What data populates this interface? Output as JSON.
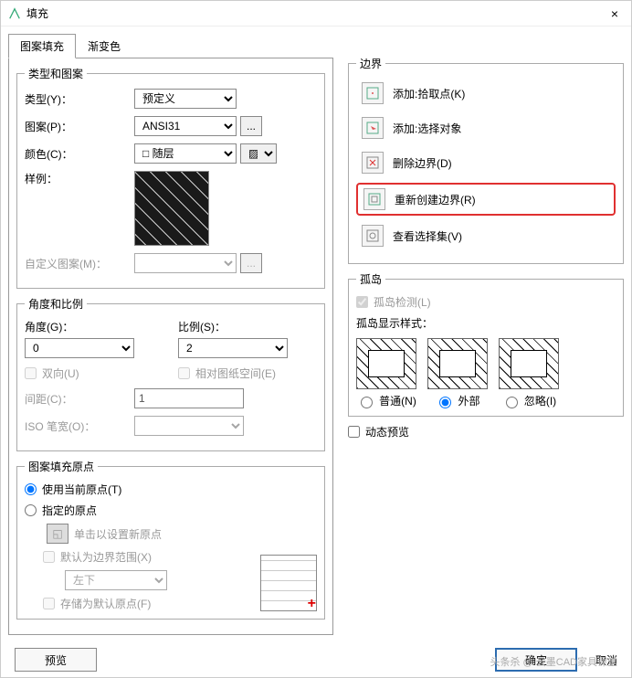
{
  "window": {
    "title": "填充",
    "close": "×"
  },
  "tabs": {
    "hatch": "图案填充",
    "gradient": "渐变色"
  },
  "typeGroup": {
    "legend": "类型和图案",
    "typeLabel": "类型(Y)：",
    "typeValue": "预定义",
    "patternLabel": "图案(P)：",
    "patternValue": "ANSI31",
    "colorLabel": "颜色(C)：",
    "colorValue": "随层",
    "sampleLabel": "样例：",
    "customLabel": "自定义图案(M)：",
    "ellipsis": "..."
  },
  "angleGroup": {
    "legend": "角度和比例",
    "angleLabel": "角度(G)：",
    "angleValue": "0",
    "scaleLabel": "比例(S)：",
    "scaleValue": "2",
    "doubleLabel": "双向(U)",
    "relativeLabel": "相对图纸空间(E)",
    "spacingLabel": "间距(C)：",
    "spacingValue": "1",
    "isoLabel": "ISO 笔宽(O)："
  },
  "originGroup": {
    "legend": "图案填充原点",
    "useCurrentLabel": "使用当前原点(T)",
    "specifyLabel": "指定的原点",
    "clickSetLabel": "单击以设置新原点",
    "defaultBoundaryLabel": "默认为边界范围(X)",
    "positionValue": "左下",
    "storeDefaultLabel": "存储为默认原点(F)"
  },
  "boundaryGroup": {
    "legend": "边界",
    "addPick": "添加:拾取点(K)",
    "addSelect": "添加:选择对象",
    "remove": "删除边界(D)",
    "recreate": "重新创建边界(R)",
    "view": "查看选择集(V)"
  },
  "islandGroup": {
    "legend": "孤岛",
    "detectLabel": "孤岛检测(L)",
    "styleLabel": "孤岛显示样式：",
    "normal": "普通(N)",
    "outer": "外部",
    "ignore": "忽略(I)"
  },
  "dynamicPreview": "动态预览",
  "footer": {
    "preview": "预览",
    "ok": "确定",
    "cancel": "取消"
  },
  "watermark": "头条杀 @ 云墨CAD家具课堂"
}
